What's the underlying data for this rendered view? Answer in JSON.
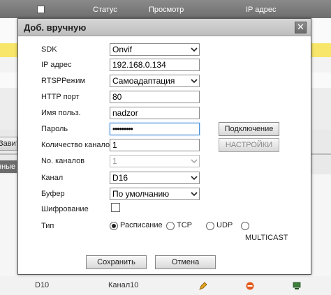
{
  "background": {
    "header": {
      "status": "Статус",
      "preview": "Просмотр",
      "ip": "IP адрес"
    },
    "left_button": "Завить",
    "left_label": "нные",
    "bottom_row": {
      "device": "D10",
      "channel": "Канал10"
    }
  },
  "dialog": {
    "title": "Доб. вручную",
    "close_glyph": "✕",
    "fields": {
      "sdk": {
        "label": "SDK",
        "value": "Onvif"
      },
      "ip": {
        "label": "IP адрес",
        "value": "192.168.0.134"
      },
      "rtsp": {
        "label": "RTSPРежим",
        "value": "Самоадаптация"
      },
      "http_port": {
        "label": "HTTP порт",
        "value": "80"
      },
      "username": {
        "label": "Имя польз.",
        "value": "nadzor"
      },
      "password": {
        "label": "Пароль",
        "value": "•••••••••"
      },
      "channel_count": {
        "label": "Количество каналов",
        "value": "1"
      },
      "no_channels": {
        "label": "No. каналов",
        "value": "1"
      },
      "channel": {
        "label": "Канал",
        "value": "D16"
      },
      "buffer": {
        "label": "Буфер",
        "value": "По умолчанию"
      },
      "encryption": {
        "label": "Шифрование",
        "checked": false
      },
      "type": {
        "label": "Тип",
        "options": [
          "Расписание",
          "TCP",
          "UDP",
          "MULTICAST"
        ],
        "selected": "Расписание"
      }
    },
    "buttons": {
      "connect": "Подключение",
      "settings": "НАСТРОЙКИ",
      "save": "Сохранить",
      "cancel": "Отмена"
    }
  },
  "colors": {
    "header_bg": "#6e6e6e",
    "highlight_row": "#f7e66a",
    "focus_border": "#4b8fd9"
  }
}
